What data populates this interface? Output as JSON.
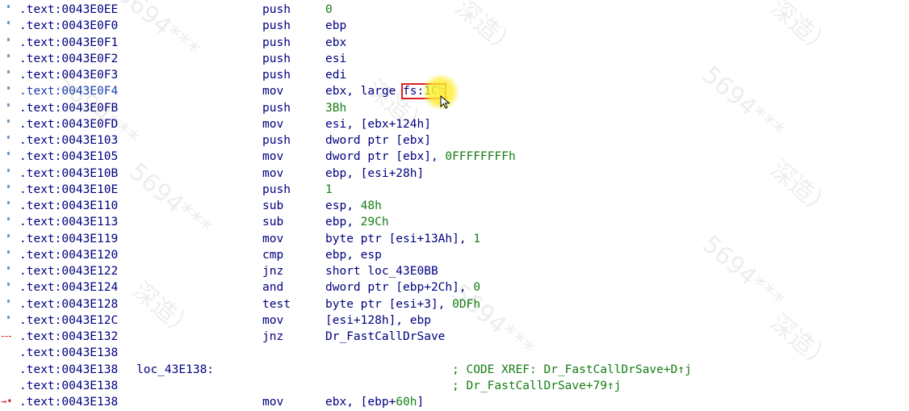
{
  "rows": [
    {
      "addr": ".text:0043E0EE",
      "label": "",
      "mnemonic": "push",
      "operands": [
        {
          "t": "0",
          "num": true
        }
      ],
      "comment": "",
      "gutter": "dot"
    },
    {
      "addr": ".text:0043E0F0",
      "label": "",
      "mnemonic": "push",
      "operands": [
        {
          "t": "ebp"
        }
      ],
      "comment": "",
      "gutter": "dot"
    },
    {
      "addr": ".text:0043E0F1",
      "label": "",
      "mnemonic": "push",
      "operands": [
        {
          "t": "ebx"
        }
      ],
      "comment": "",
      "gutter": "dot"
    },
    {
      "addr": ".text:0043E0F2",
      "label": "",
      "mnemonic": "push",
      "operands": [
        {
          "t": "esi"
        }
      ],
      "comment": "",
      "gutter": "dot"
    },
    {
      "addr": ".text:0043E0F3",
      "label": "",
      "mnemonic": "push",
      "operands": [
        {
          "t": "edi"
        }
      ],
      "comment": "",
      "gutter": "dot"
    },
    {
      "addr": ".text:0043E0F4",
      "label": "",
      "mnemonic": "mov",
      "operands": [
        {
          "t": "ebx, large "
        },
        {
          "t": "fs:",
          "hl": "start"
        },
        {
          "t": "1Ch",
          "num": true,
          "hl": "end"
        }
      ],
      "comment": "",
      "gutter": "dot",
      "current": true
    },
    {
      "addr": ".text:0043E0FB",
      "label": "",
      "mnemonic": "push",
      "operands": [
        {
          "t": "3Bh",
          "num": true
        }
      ],
      "comment": "",
      "gutter": "dot"
    },
    {
      "addr": ".text:0043E0FD",
      "label": "",
      "mnemonic": "mov",
      "operands": [
        {
          "t": "esi, [ebx+124h]"
        }
      ],
      "comment": "",
      "gutter": "dot"
    },
    {
      "addr": ".text:0043E103",
      "label": "",
      "mnemonic": "push",
      "operands": [
        {
          "t": "dword ptr [ebx]"
        }
      ],
      "comment": "",
      "gutter": "dot"
    },
    {
      "addr": ".text:0043E105",
      "label": "",
      "mnemonic": "mov",
      "operands": [
        {
          "t": "dword ptr [ebx], "
        },
        {
          "t": "0FFFFFFFFh",
          "num": true
        }
      ],
      "comment": "",
      "gutter": "dot"
    },
    {
      "addr": ".text:0043E10B",
      "label": "",
      "mnemonic": "mov",
      "operands": [
        {
          "t": "ebp, [esi+28h]"
        }
      ],
      "comment": "",
      "gutter": "dot"
    },
    {
      "addr": ".text:0043E10E",
      "label": "",
      "mnemonic": "push",
      "operands": [
        {
          "t": "1",
          "num": true
        }
      ],
      "comment": "",
      "gutter": "dot"
    },
    {
      "addr": ".text:0043E110",
      "label": "",
      "mnemonic": "sub",
      "operands": [
        {
          "t": "esp, "
        },
        {
          "t": "48h",
          "num": true
        }
      ],
      "comment": "",
      "gutter": "dot"
    },
    {
      "addr": ".text:0043E113",
      "label": "",
      "mnemonic": "sub",
      "operands": [
        {
          "t": "ebp, "
        },
        {
          "t": "29Ch",
          "num": true
        }
      ],
      "comment": "",
      "gutter": "dot"
    },
    {
      "addr": ".text:0043E119",
      "label": "",
      "mnemonic": "mov",
      "operands": [
        {
          "t": "byte ptr [esi+13Ah], "
        },
        {
          "t": "1",
          "num": true
        }
      ],
      "comment": "",
      "gutter": "dot"
    },
    {
      "addr": ".text:0043E120",
      "label": "",
      "mnemonic": "cmp",
      "operands": [
        {
          "t": "ebp, esp"
        }
      ],
      "comment": "",
      "gutter": "dot"
    },
    {
      "addr": ".text:0043E122",
      "label": "",
      "mnemonic": "jnz",
      "operands": [
        {
          "t": "short loc_43E0BB"
        }
      ],
      "comment": "",
      "gutter": "dot"
    },
    {
      "addr": ".text:0043E124",
      "label": "",
      "mnemonic": "and",
      "operands": [
        {
          "t": "dword ptr [ebp+2Ch], "
        },
        {
          "t": "0",
          "num": true
        }
      ],
      "comment": "",
      "gutter": "dot"
    },
    {
      "addr": ".text:0043E128",
      "label": "",
      "mnemonic": "test",
      "operands": [
        {
          "t": "byte ptr [esi+3], "
        },
        {
          "t": "0DFh",
          "num": true
        }
      ],
      "comment": "",
      "gutter": "dot"
    },
    {
      "addr": ".text:0043E12C",
      "label": "",
      "mnemonic": "mov",
      "operands": [
        {
          "t": "[esi+128h], ebp"
        }
      ],
      "comment": "",
      "gutter": "dot"
    },
    {
      "addr": ".text:0043E132",
      "label": "",
      "mnemonic": "jnz",
      "operands": [
        {
          "t": "Dr_FastCallDrSave"
        }
      ],
      "comment": "",
      "gutter": "jump"
    },
    {
      "addr": ".text:0043E138",
      "label": "",
      "mnemonic": "",
      "operands": [],
      "comment": "",
      "gutter": ""
    },
    {
      "addr": ".text:0043E138",
      "label": "loc_43E138:",
      "mnemonic": "",
      "operands": [],
      "comment": "; CODE XREF: Dr_FastCallDrSave+D↑j",
      "gutter": ""
    },
    {
      "addr": ".text:0043E138",
      "label": "",
      "mnemonic": "",
      "operands": [],
      "comment": "; Dr_FastCallDrSave+79↑j",
      "gutter": ""
    },
    {
      "addr": ".text:0043E138",
      "label": "",
      "mnemonic": "mov",
      "operands": [
        {
          "t": "ebx, [ebp+"
        },
        {
          "t": "60h",
          "num": true
        },
        {
          "t": "]"
        }
      ],
      "comment": "",
      "gutter": "arrow"
    }
  ],
  "gutter_glyphs": {
    "arrow": "→•"
  },
  "colors": {
    "address": "#000080",
    "number": "#157d15",
    "comment": "#157d15",
    "highlight_box": "#e02020",
    "cursor_glow": "#ffec28"
  },
  "icons": {
    "cursor": "mouse-pointer-icon"
  },
  "watermarks": [
    {
      "text": "5694***"
    },
    {
      "text": "深造）"
    },
    {
      "text": "5694***"
    },
    {
      "text": "深造）"
    },
    {
      "text": "5694***"
    },
    {
      "text": "深造）"
    },
    {
      "text": "5694***"
    },
    {
      "text": "深造）"
    },
    {
      "text": "5694***"
    },
    {
      "text": "深造）"
    },
    {
      "text": "5694***"
    },
    {
      "text": "深造）"
    }
  ]
}
